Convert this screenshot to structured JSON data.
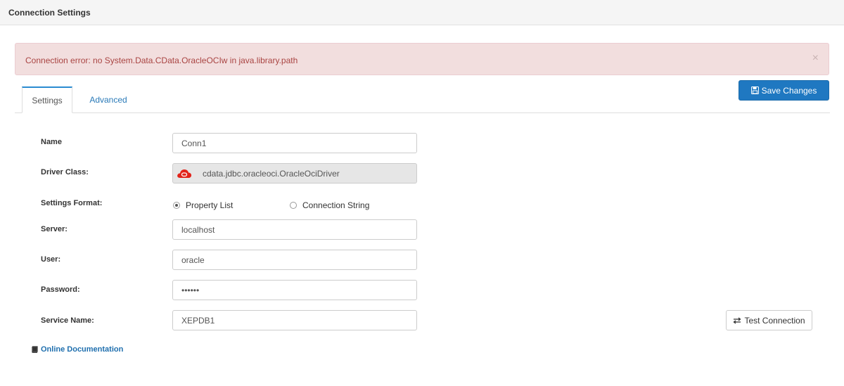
{
  "header": {
    "title": "Connection Settings"
  },
  "alert": {
    "message": "Connection error: no System.Data.CData.OracleOCIw in java.library.path",
    "close": "×"
  },
  "tabs": [
    {
      "label": "Settings",
      "active": true
    },
    {
      "label": "Advanced",
      "active": false
    }
  ],
  "toolbar": {
    "save_label": "Save Changes"
  },
  "form": {
    "name": {
      "label": "Name",
      "value": "Conn1"
    },
    "driver_class": {
      "label": "Driver Class:",
      "value": "cdata.jdbc.oracleoci.OracleOciDriver",
      "icon": "oracle-cloud-icon"
    },
    "settings_format": {
      "label": "Settings Format:",
      "options": [
        {
          "label": "Property List",
          "selected": true
        },
        {
          "label": "Connection String",
          "selected": false
        }
      ]
    },
    "server": {
      "label": "Server:",
      "value": "localhost"
    },
    "user": {
      "label": "User:",
      "value": "oracle"
    },
    "password": {
      "label": "Password:",
      "value": "••••••"
    },
    "service_name": {
      "label": "Service Name:",
      "value": "XEPDB1"
    }
  },
  "test_connection": {
    "label": "Test Connection"
  },
  "online_documentation": {
    "label": "Online Documentation"
  },
  "colors": {
    "primary": "#1f78c1",
    "alert_bg": "#f2dede",
    "alert_text": "#a94442",
    "link": "#2a7ab8",
    "driver_icon": "#e2231a"
  }
}
